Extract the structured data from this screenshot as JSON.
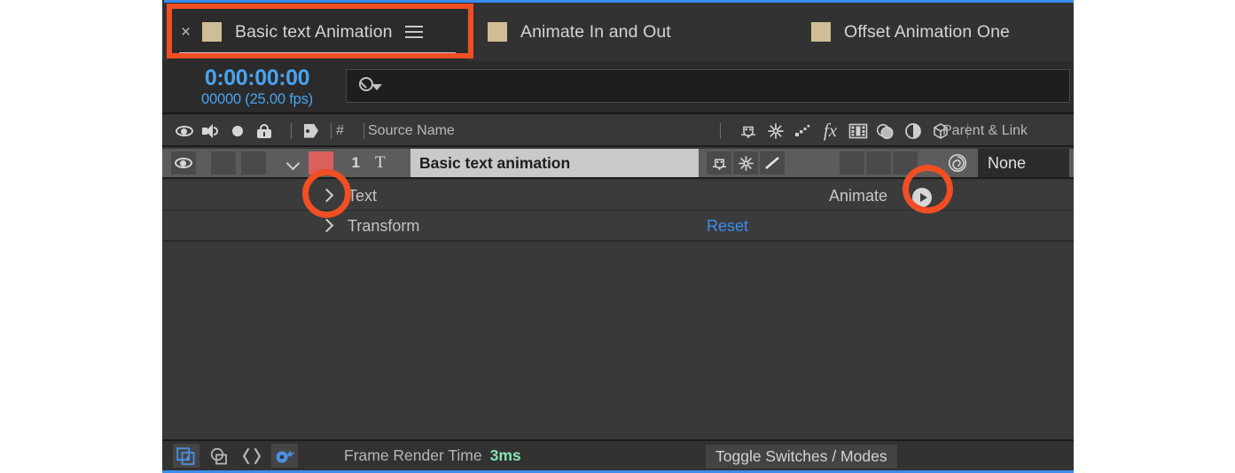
{
  "tabs": [
    {
      "label": "Basic text Animation",
      "active": true,
      "swatch": "#cfbd95",
      "close_icon": "×",
      "menu_icon": "hamburger-menu-icon"
    },
    {
      "label": "Animate In and Out",
      "active": false,
      "swatch": "#cfbd95"
    },
    {
      "label": "Offset Animation One",
      "active": false,
      "swatch": "#cfbd95"
    }
  ],
  "timecode": {
    "current": "0:00:00:00",
    "frames_and_fps": "00000 (25.00 fps)"
  },
  "search": {
    "value": "",
    "placeholder": "",
    "icon": "search-icon"
  },
  "columns": {
    "av_icons": [
      "eye-icon",
      "audio-icon",
      "solo-icon",
      "lock-icon"
    ],
    "label_icon": "label-tag-icon",
    "number": "#",
    "source_name": "Source Name",
    "switch_icons": [
      "shy-icon",
      "collapse-transformations-icon",
      "quality-icon",
      "effects-icon",
      "frame-blending-icon",
      "motion-blur-icon",
      "adjustment-layer-icon",
      "3d-layer-icon"
    ],
    "parent_and_link": "Parent & Link"
  },
  "layer": {
    "visible": true,
    "eye_icon": "eye-icon",
    "twirl_icon": "chevron-down-icon",
    "label_color": "#d9605b",
    "index": "1",
    "type_icon": "text-layer-T-icon",
    "name": "Basic text animation",
    "switches_on": [
      "shy-icon",
      "collapse-transformations-icon",
      "quality-icon"
    ],
    "parent_pickwhip_icon": "pick-whip-icon",
    "parent": "None"
  },
  "properties": [
    {
      "name": "Text",
      "twirl_icon": "chevron-right-icon",
      "action_label": "Animate",
      "action_icon": "animate-play-icon"
    },
    {
      "name": "Transform",
      "twirl_icon": "chevron-right-icon",
      "reset_label": "Reset"
    }
  ],
  "bottom_bar": {
    "icons": [
      {
        "name": "frame-blending-toggle-icon",
        "active": true
      },
      {
        "name": "motion-blur-toggle-icon",
        "active": false
      },
      {
        "name": "graph-editor-icon",
        "active": false
      },
      {
        "name": "draft-3d-snail-icon",
        "active": true
      }
    ],
    "frame_render_time_label": "Frame Render Time",
    "frame_render_time_value": "3ms",
    "toggle_switches_modes": "Toggle Switches / Modes"
  },
  "annotations": {
    "color": "#f04e23",
    "shapes": [
      "rect-around-active-tab",
      "circle-around-text-twirl",
      "circle-around-animate-button"
    ]
  }
}
